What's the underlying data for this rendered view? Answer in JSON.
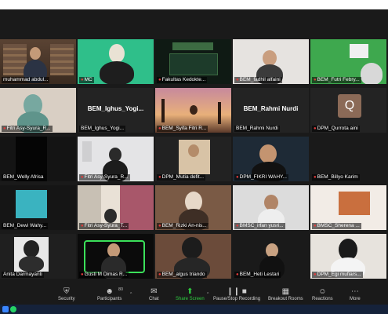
{
  "participants": [
    {
      "name": "muhammad abdul...",
      "muted": false
    },
    {
      "name": "MC",
      "muted": true
    },
    {
      "name": "Fakultas Kedokte...",
      "muted": true
    },
    {
      "name": "BEM_fadhil alfaini",
      "muted": true
    },
    {
      "name": "BEM_Futri Febry...",
      "muted": true
    },
    {
      "name": "Fitri Asy-Syura_R...",
      "muted": true
    },
    {
      "name": "BEM_Ighus_Yogi...",
      "muted": false,
      "video_off": true
    },
    {
      "name": "BEM_Syifa Fitri R...",
      "muted": true
    },
    {
      "name": "BEM_Rahmi Nurdi",
      "muted": false,
      "video_off": true
    },
    {
      "name": "DPM_Qurrota aini",
      "muted": true,
      "avatar_letter": "Q"
    },
    {
      "name": "BEM_Welly Afrisa",
      "muted": false
    },
    {
      "name": "Fitri Asy-Syura_R...",
      "muted": true
    },
    {
      "name": "DPM_Mutia defit...",
      "muted": true
    },
    {
      "name": "DPM_FIKRI WAHY...",
      "muted": true
    },
    {
      "name": "BEM_Billyo Karim",
      "muted": true
    },
    {
      "name": "BEM_Dewi Wahy...",
      "muted": false
    },
    {
      "name": "Fitri Asy-Syura_T...",
      "muted": true
    },
    {
      "name": "BEM_Rizki An-nis...",
      "muted": true
    },
    {
      "name": "BMSC_irfan yusri...",
      "muted": true
    },
    {
      "name": "BMSC_Sherena ...",
      "muted": true
    },
    {
      "name": "Anita Darmayanti",
      "muted": false
    },
    {
      "name": "Gusti M Dimas R...",
      "muted": true
    },
    {
      "name": "BEM_algus triando",
      "muted": true
    },
    {
      "name": "BEM_Heti Lestari",
      "muted": true
    },
    {
      "name": "DPM_Egi mufiars...",
      "muted": true
    }
  ],
  "toolbar": {
    "security": "Security",
    "participants": "Participants",
    "participants_count": "80",
    "chat": "Chat",
    "share_screen": "Share Screen",
    "record": "Pause/Stop Recording",
    "breakout": "Breakout Rooms",
    "reactions": "Reactions",
    "more": "More"
  },
  "colors": {
    "active_speaker": "#e8d23a",
    "share_green": "#2ecc40",
    "mute_red": "#e23b3b"
  }
}
